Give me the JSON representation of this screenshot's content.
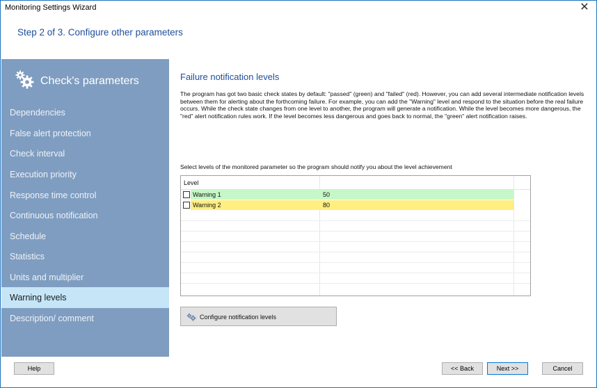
{
  "window": {
    "title": "Monitoring Settings Wizard",
    "close_glyph": "✕"
  },
  "step": "Step 2 of 3. Configure other parameters",
  "sidebar": {
    "title": "Check's parameters",
    "header_icon": "gears-icon",
    "items": [
      {
        "label": "Dependencies",
        "active": false
      },
      {
        "label": "False alert protection",
        "active": false
      },
      {
        "label": "Check interval",
        "active": false
      },
      {
        "label": "Execution priority",
        "active": false
      },
      {
        "label": "Response time control",
        "active": false
      },
      {
        "label": "Continuous notification",
        "active": false
      },
      {
        "label": "Schedule",
        "active": false
      },
      {
        "label": "Statistics",
        "active": false
      },
      {
        "label": "Units and multiplier",
        "active": false
      },
      {
        "label": "Warning levels",
        "active": true
      },
      {
        "label": "Description/ comment",
        "active": false
      }
    ]
  },
  "content": {
    "title": "Failure notification levels",
    "description": "The program has got two basic check states by default: \"passed\" (green) and \"failed\" (red). However, you can add several intermediate notification levels between them for alerting about the forthcoming failure. For example, you can add the \"Warning\" level and respond to the situation before the real failure occurs. While the check state changes from one level to another, the program will generate a notification. While the level becomes more dangerous, the \"red\" alert notification rules work. If the level becomes less dangerous and goes back to normal, the \"green\" alert notification raises.",
    "select_label": "Select levels of the monitored parameter so the program should notify you about the level achievement",
    "grid": {
      "column_header": "Level",
      "rows": [
        {
          "name": "Warning 1",
          "value": "50",
          "checked": false,
          "color": "#c6f7c6"
        },
        {
          "name": "Warning 2",
          "value": "80",
          "checked": false,
          "color": "#ffee80"
        }
      ]
    },
    "configure_button": "Configure notification levels",
    "configure_icon": "gears-icon"
  },
  "footer": {
    "help": "Help",
    "back": "<< Back",
    "next": "Next >>",
    "cancel": "Cancel"
  },
  "colors": {
    "sidebar_bg": "#7f9dc0",
    "sidebar_active": "#c6e6f7",
    "accent_text": "#1f4e9c"
  }
}
